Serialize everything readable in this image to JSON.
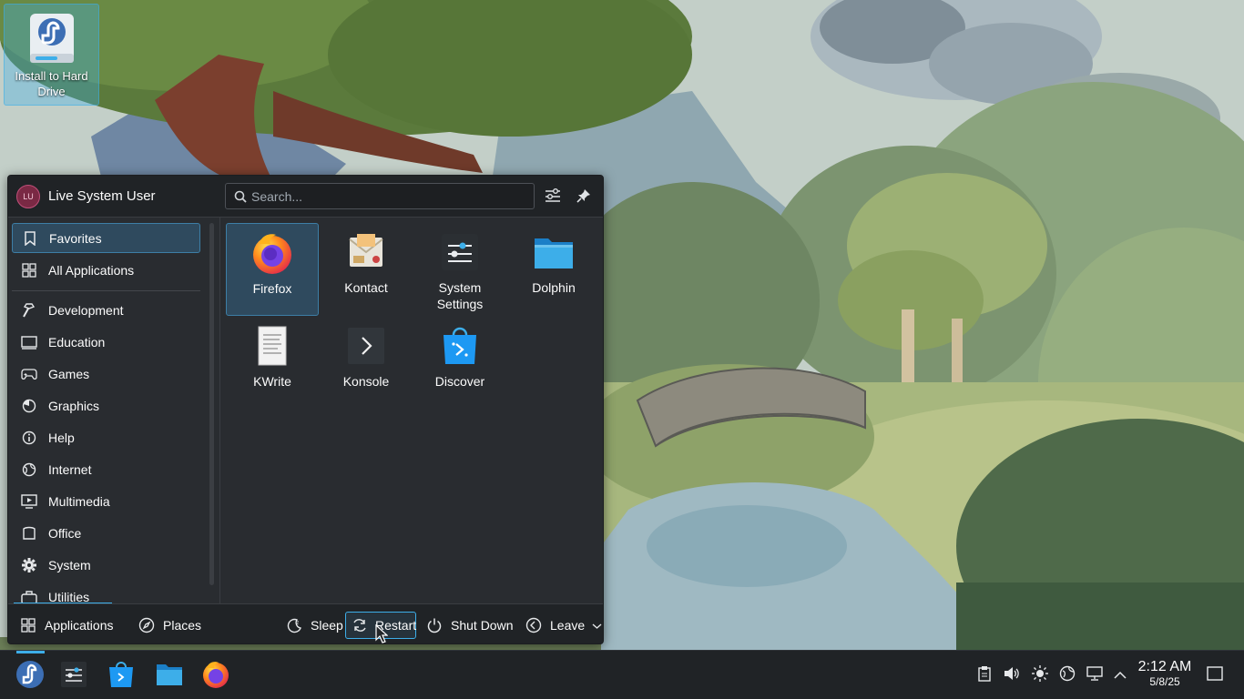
{
  "desktop": {
    "icons": [
      {
        "label": "Install to Hard Drive",
        "icon": "fedora-installer-icon"
      }
    ]
  },
  "launcher": {
    "user": {
      "name": "Live System User",
      "initials": "LU"
    },
    "search": {
      "placeholder": "Search...",
      "value": ""
    },
    "header_buttons": [
      {
        "icon": "configure-icon"
      },
      {
        "icon": "pin-icon"
      }
    ],
    "categories": [
      {
        "label": "Favorites",
        "icon": "bookmark-icon",
        "selected": true
      },
      {
        "label": "All Applications",
        "icon": "grid-icon"
      },
      {
        "label": "Development",
        "icon": "hammer-icon"
      },
      {
        "label": "Education",
        "icon": "education-icon"
      },
      {
        "label": "Games",
        "icon": "gamepad-icon"
      },
      {
        "label": "Graphics",
        "icon": "graphics-icon"
      },
      {
        "label": "Help",
        "icon": "help-icon"
      },
      {
        "label": "Internet",
        "icon": "globe-icon"
      },
      {
        "label": "Multimedia",
        "icon": "multimedia-icon"
      },
      {
        "label": "Office",
        "icon": "office-icon"
      },
      {
        "label": "System",
        "icon": "gear-icon"
      },
      {
        "label": "Utilities",
        "icon": "utilities-icon"
      }
    ],
    "favorites": [
      {
        "label": "Firefox",
        "icon": "firefox-icon",
        "selected": true
      },
      {
        "label": "Kontact",
        "icon": "kontact-icon"
      },
      {
        "label": "System Settings",
        "icon": "system-settings-icon"
      },
      {
        "label": "Dolphin",
        "icon": "dolphin-folder-icon"
      },
      {
        "label": "KWrite",
        "icon": "kwrite-icon"
      },
      {
        "label": "Konsole",
        "icon": "konsole-icon"
      },
      {
        "label": "Discover",
        "icon": "discover-icon"
      }
    ],
    "footer": {
      "tabs": [
        {
          "label": "Applications",
          "icon": "grid-icon",
          "active": true
        },
        {
          "label": "Places",
          "icon": "compass-icon"
        }
      ],
      "actions": [
        {
          "label": "Sleep",
          "icon": "sleep-icon"
        },
        {
          "label": "Restart",
          "icon": "restart-icon",
          "focused": true
        },
        {
          "label": "Shut Down",
          "icon": "power-icon"
        },
        {
          "label": "Leave",
          "icon": "leave-icon",
          "has_dropdown": true
        }
      ]
    }
  },
  "taskbar": {
    "apps": [
      {
        "name": "Application Launcher",
        "icon": "fedora-launcher-icon",
        "active": true
      },
      {
        "name": "System Settings",
        "icon": "system-settings-icon"
      },
      {
        "name": "Discover",
        "icon": "discover-icon"
      },
      {
        "name": "Dolphin",
        "icon": "dolphin-folder-icon"
      },
      {
        "name": "Firefox",
        "icon": "firefox-icon"
      }
    ],
    "tray": [
      {
        "icon": "clipboard-icon"
      },
      {
        "icon": "volume-icon"
      },
      {
        "icon": "brightness-icon"
      },
      {
        "icon": "network-icon"
      },
      {
        "icon": "display-icon"
      },
      {
        "icon": "chevron-up-icon"
      }
    ],
    "clock": {
      "time": "2:12 AM",
      "date": "5/8/25"
    },
    "show_desktop": {
      "icon": "show-desktop-icon"
    }
  },
  "colors": {
    "accent": "#3daee9",
    "panel": "#202326",
    "menu": "#292c30",
    "selection": "#2f4a5e"
  }
}
